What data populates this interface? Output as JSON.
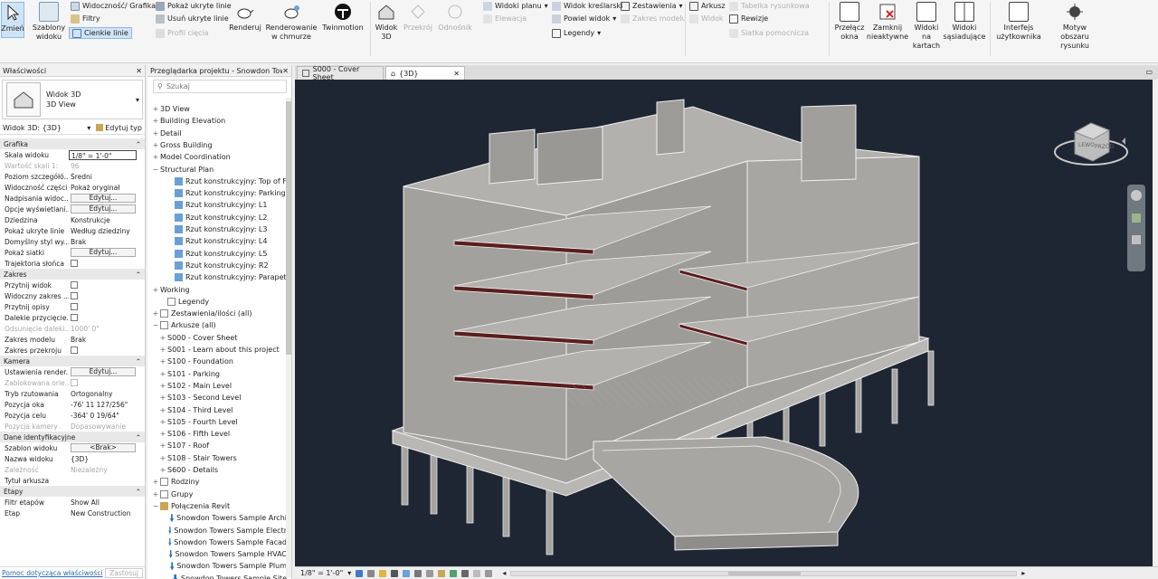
{
  "ribbon": {
    "modify": "Zmień",
    "templates": "Szablony\nwidoku",
    "vg": "Widoczność/ Grafika",
    "filters": "Filtry",
    "thin_lines": "Cienkie linie",
    "show_hidden": "Pokaż ukryte linie",
    "remove_hidden": "Usuń ukryte linie",
    "cut_profile": "Profil cięcia",
    "render": "Renderuj",
    "cloud_render": "Renderowanie\nw chmurze",
    "twinmotion": "Twinmotion",
    "view3d": "Widok\n3D",
    "section": "Przekrój",
    "callout": "Odnośnik",
    "plan_views": "Widoki planu",
    "elevation": "Elewacja",
    "drafting": "Widok kreślarski",
    "duplicate": "Powiel widok",
    "legends": "Legendy",
    "schedules": "Zestawienia",
    "scope_box": "Zakres modelu",
    "sheet": "Arkusz",
    "view": "Widok",
    "title_block": "Tabelka rysunkowa",
    "revisions": "Rewizje",
    "guide_grid": "Siatka pomocnicza",
    "switch": "Przełącz\nokna",
    "close_inactive": "Zamknij\nnieaktywne",
    "tab_views": "Widoki\nna kartach",
    "tile_views": "Widoki\nsąsiadujące",
    "ui": "Interfejs\nużytkownika",
    "bg_theme": "Motyw\nobszaru rysunku"
  },
  "props": {
    "header": "Właściwości",
    "type1": "Widok 3D",
    "type2": "3D View",
    "selector": "Widok 3D: {3D}",
    "edit_type": "Edytuj typ",
    "help": "Pomoc dotycząca właściwości",
    "apply": "Zastosuj",
    "sections": {
      "graphics": "Grafika",
      "extents": "Zakres",
      "camera": "Kamera",
      "identity": "Dane identyfikacyjne",
      "phasing": "Etapy"
    },
    "rows": {
      "scale_k": "Skala widoku",
      "scale_v": "1/8\" = 1'-0\"",
      "scale_val_k": "Wartość skali    1:",
      "scale_val_v": "96",
      "detail_k": "Poziom szczegółó...",
      "detail_v": "Średni",
      "parts_k": "Widoczność części",
      "parts_v": "Pokaż oryginał",
      "vg_over_k": "Nadpisania widoc...",
      "vg_over_v": "Edytuj...",
      "disp_opt_k": "Opcje wyświetlani...",
      "disp_opt_v": "Edytuj...",
      "discipline_k": "Dziedzina",
      "discipline_v": "Konstrukcje",
      "hidden_k": "Pokaż ukryte linie",
      "hidden_v": "Według dziedziny",
      "default_k": "Domyślny styl wy...",
      "default_v": "Brak",
      "grid_k": "Pokaż siatki",
      "grid_v": "Edytuj...",
      "sun_k": "Trajektoria słońca",
      "crop_k": "Przytnij widok",
      "crop_vis_k": "Widoczny zakres ...",
      "annot_k": "Przytnij opisy",
      "far_k": "Dalekie przycięcie...",
      "far_off_k": "Odsunięcie daleki...",
      "far_off_v": "1000' 0\"",
      "model_k": "Zakres modelu",
      "model_v": "Brak",
      "section_k": "Zakres przekroju",
      "render_k": "Ustawienia render...",
      "render_v": "Edytuj...",
      "locked_k": "Zablokowana orie...",
      "proj_k": "Tryb rzutowania",
      "proj_v": "Ortogonalny",
      "eye_k": "Pozycja oka",
      "eye_v": "-76' 11 127/256\"",
      "target_k": "Pozycja celu",
      "target_v": "-364' 0 19/64\"",
      "campos_k": "Pozycja kamery",
      "campos_v": "Dopasowywanie",
      "template_k": "Szablon widoku",
      "template_v": "<Brak>",
      "name_k": "Nazwa widoku",
      "name_v": "{3D}",
      "dep_k": "Zależność",
      "dep_v": "Niezależny",
      "title_k": "Tytuł arkusza",
      "filter_k": "Filtr etapów",
      "filter_v": "Show All",
      "phase_k": "Etap",
      "phase_v": "New Construction"
    }
  },
  "browser": {
    "header": "Przeglądarka projektu - Snowdon Tower...",
    "search": "Szukaj",
    "items": [
      "3D View",
      "Building Elevation",
      "Detail",
      "Gross Building",
      "Model Coordination",
      "Structural Plan",
      "Rzut konstrukcyjny: Top of F",
      "Rzut konstrukcyjny: Parking",
      "Rzut konstrukcyjny: L1",
      "Rzut konstrukcyjny: L2",
      "Rzut konstrukcyjny: L3",
      "Rzut konstrukcyjny: L4",
      "Rzut konstrukcyjny: L5",
      "Rzut konstrukcyjny: R2",
      "Rzut konstrukcyjny: Parapet",
      "Working",
      "Legendy",
      "Zestawienia/ilości (all)",
      "Arkusze (all)",
      "S000 - Cover Sheet",
      "S001 - Learn about this project",
      "S100 - Foundation",
      "S101 - Parking",
      "S102 - Main Level",
      "S103 - Second Level",
      "S104 - Third Level",
      "S105 - Fourth Level",
      "S106 - Fifth Level",
      "S107 - Roof",
      "S108 - Stair Towers",
      "S600 - Details",
      "Rodziny",
      "Grupy",
      "Połączenia Revit",
      "Snowdon Towers Sample Archi",
      "Snowdon Towers Sample Electr",
      "Snowdon Towers Sample Facad",
      "Snowdon Towers Sample HVAC",
      "Snowdon Towers Sample Plum",
      "Snowdon Towers Sample Site"
    ]
  },
  "tabs": [
    {
      "label": "S000 - Cover Sheet"
    },
    {
      "label": "{3D}"
    }
  ],
  "viewbar": {
    "scale": "1/8\" = 1'-0\""
  },
  "viewcube": {
    "left": "LEWO",
    "front": "PRZÓD"
  },
  "colors": {
    "viewport": "#1f2633",
    "model": "#a3a19e",
    "accent": "#2b6fb3",
    "cut": "#5a1e1e"
  }
}
